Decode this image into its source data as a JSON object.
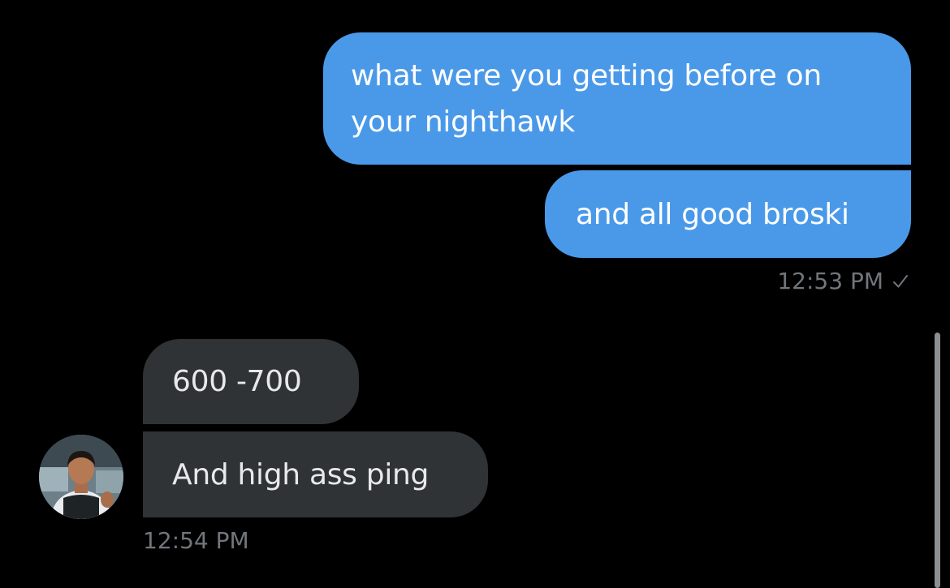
{
  "conversation": {
    "messages": [
      {
        "direction": "sent",
        "text": "what were you getting before on your nighthawk"
      },
      {
        "direction": "sent",
        "text": "and all good broski"
      },
      {
        "direction": "received",
        "text": "600 -700"
      },
      {
        "direction": "received",
        "text": "And high ass ping"
      }
    ],
    "sent_timestamp": "12:53 PM",
    "received_timestamp": "12:54 PM",
    "sent_status_icon": "checkmark-icon"
  },
  "colors": {
    "background": "#000000",
    "sent_bubble": "#4a99e9",
    "received_bubble": "#2f3336",
    "timestamp": "#71767b"
  }
}
